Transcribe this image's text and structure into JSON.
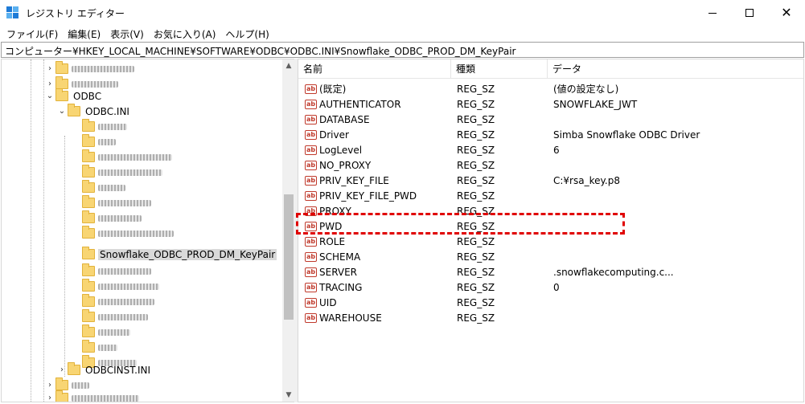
{
  "window": {
    "title": "レジストリ エディター",
    "icon": "regedit-icon",
    "controls": {
      "minimize": "minimize-icon",
      "maximize": "maximize-icon",
      "close": "✕"
    }
  },
  "menu": [
    "ファイル(F)",
    "編集(E)",
    "表示(V)",
    "お気に入り(A)",
    "ヘルプ(H)"
  ],
  "address": "コンピューター¥HKEY_LOCAL_MACHINE¥SOFTWARE¥ODBC¥ODBC.INI¥Snowflake_ODBC_PROD_DM_KeyPair",
  "tree": {
    "odbc": "ODBC",
    "odbc_ini": "ODBC.INI",
    "selected": "Snowflake_ODBC_PROD_DM_KeyPair",
    "odbcinst": "ODBCINST.INI"
  },
  "columns": {
    "name": "名前",
    "type": "種類",
    "data": "データ"
  },
  "values": [
    {
      "name": "(既定)",
      "type": "REG_SZ",
      "data": "(値の設定なし)"
    },
    {
      "name": "AUTHENTICATOR",
      "type": "REG_SZ",
      "data": "SNOWFLAKE_JWT"
    },
    {
      "name": "DATABASE",
      "type": "REG_SZ",
      "data": ""
    },
    {
      "name": "Driver",
      "type": "REG_SZ",
      "data": "Simba Snowflake ODBC Driver"
    },
    {
      "name": "LogLevel",
      "type": "REG_SZ",
      "data": "6"
    },
    {
      "name": "NO_PROXY",
      "type": "REG_SZ",
      "data": ""
    },
    {
      "name": "PRIV_KEY_FILE",
      "type": "REG_SZ",
      "data": "C:¥rsa_key.p8"
    },
    {
      "name": "PRIV_KEY_FILE_PWD",
      "type": "REG_SZ",
      "data": ""
    },
    {
      "name": "PROXY",
      "type": "REG_SZ",
      "data": ""
    },
    {
      "name": "PWD",
      "type": "REG_SZ",
      "data": ""
    },
    {
      "name": "ROLE",
      "type": "REG_SZ",
      "data": ""
    },
    {
      "name": "SCHEMA",
      "type": "REG_SZ",
      "data": ""
    },
    {
      "name": "SERVER",
      "type": "REG_SZ",
      "data": ".snowflakecomputing.c..."
    },
    {
      "name": "TRACING",
      "type": "REG_SZ",
      "data": "0"
    },
    {
      "name": "UID",
      "type": "REG_SZ",
      "data": ""
    },
    {
      "name": "WAREHOUSE",
      "type": "REG_SZ",
      "data": ""
    }
  ],
  "value_icon_label": "ab",
  "colors": {
    "highlight": "#e00000",
    "folder": "#f8d573"
  }
}
